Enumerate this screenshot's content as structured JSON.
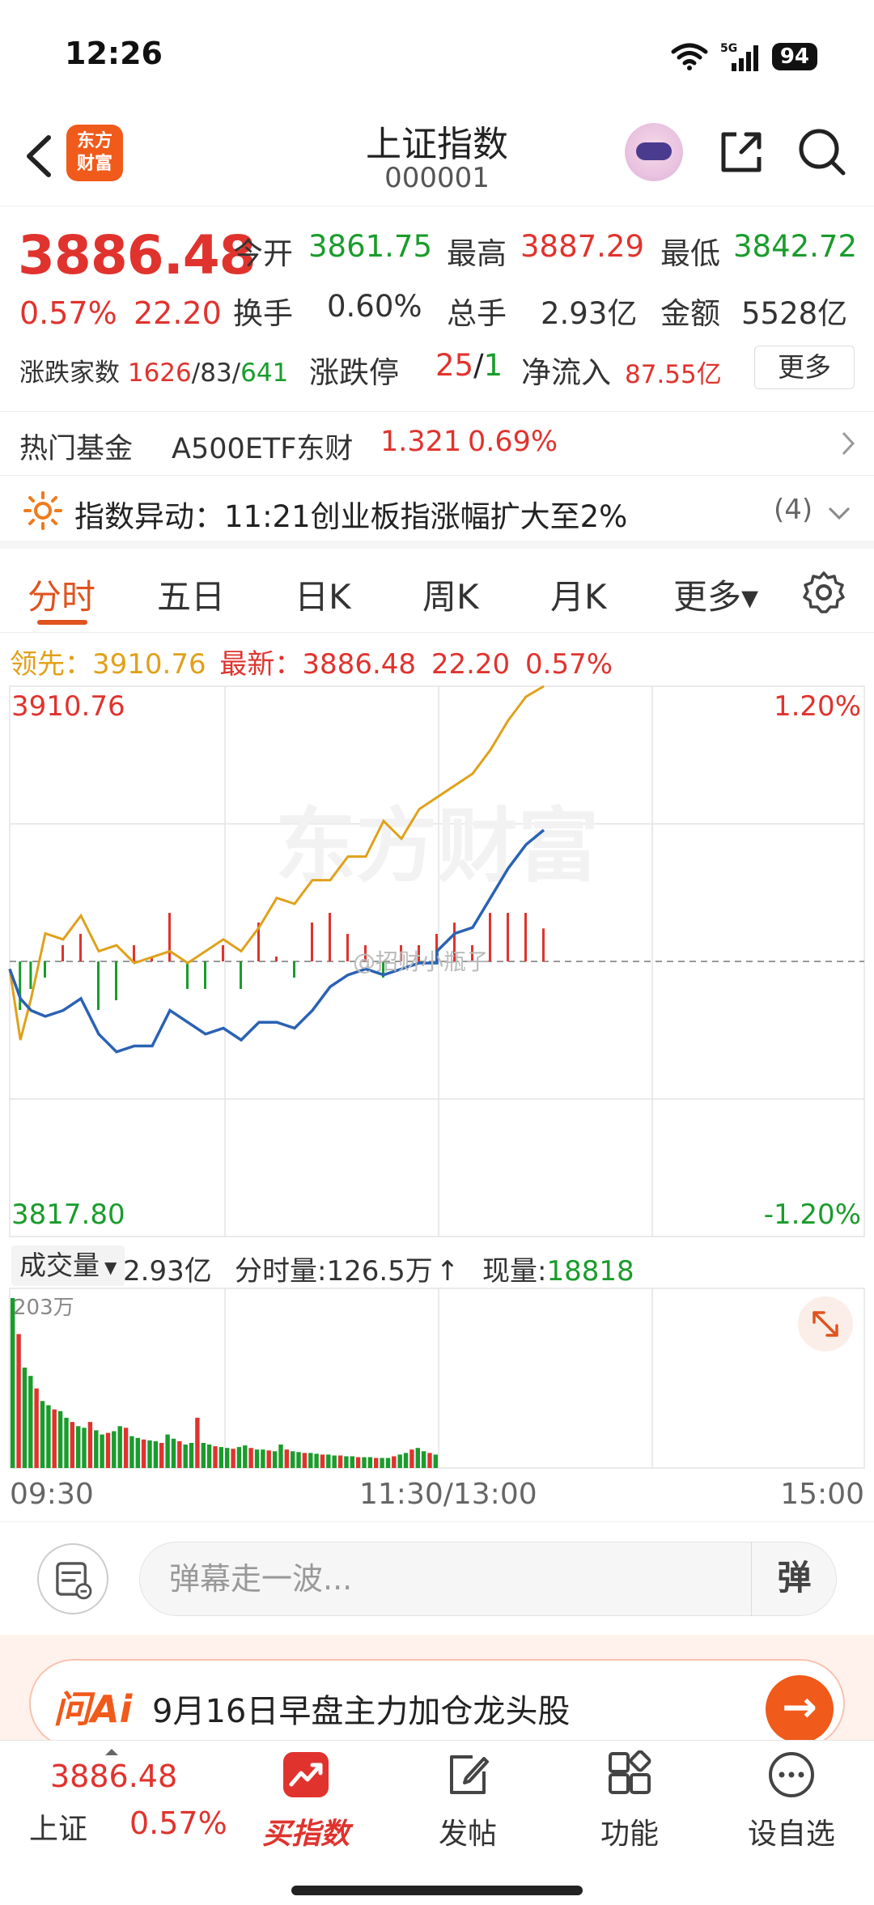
{
  "status_bar": {
    "time": "12:26",
    "battery": "94",
    "network": "5G"
  },
  "header": {
    "title": "上证指数",
    "code": "000001",
    "logo_text_line1": "东方",
    "logo_text_line2": "财富"
  },
  "quote": {
    "last_price": "3886.48",
    "pct_change": "0.57%",
    "abs_change": "22.20",
    "open_label": "今开",
    "open": "3861.75",
    "high_label": "最高",
    "high": "3887.29",
    "low_label": "最低",
    "low": "3842.72",
    "turnover_label": "换手",
    "turnover": "0.60%",
    "volume_label": "总手",
    "volume": "2.93亿",
    "amount_label": "金额",
    "amount": "5528亿",
    "adv_label": "涨跌家数",
    "adv_up": "1626",
    "adv_flat": "83",
    "adv_down": "641",
    "sep": "/",
    "limit_label": "涨跌停",
    "limit_up": "25",
    "limit_down": "1",
    "netflow_label": "净流入",
    "netflow": "87.55亿",
    "more_label": "更多"
  },
  "hot_fund": {
    "label": "热门基金",
    "name": "A500ETF东财",
    "price": "1.321",
    "pct": "0.69%"
  },
  "alert": {
    "label": "指数异动：",
    "text": "11:21创业板指涨幅扩大至2%",
    "count": "(4)"
  },
  "tabs": [
    {
      "label": "分时"
    },
    {
      "label": "五日"
    },
    {
      "label": "日K"
    },
    {
      "label": "周K"
    },
    {
      "label": "月K"
    },
    {
      "label": "更多▾"
    }
  ],
  "legend": {
    "lead_label": "领先：",
    "lead_value": "3910.76",
    "latest_label": "最新：",
    "latest_value": "3886.48",
    "latest_change": "22.20",
    "latest_pct": "0.57%"
  },
  "chart_labels": {
    "y_top": "3910.76",
    "y_bottom": "3817.80",
    "pct_top": "1.20%",
    "pct_bottom": "-1.20%",
    "watermark": "东方财富",
    "user_watermark": "@招财小瓶子"
  },
  "volume_bar": {
    "indicator": "成交量",
    "total": "2.93亿",
    "minute_label": "分时量:",
    "minute_value": "126.5万",
    "arrow": "↑",
    "now_label": "现量:",
    "now_value": "18818",
    "max_label": "203万"
  },
  "time_axis": {
    "start": "09:30",
    "mid": "11:30/13:00",
    "end": "15:00"
  },
  "danmaku": {
    "placeholder": "弹幕走一波...",
    "send_label": "弹"
  },
  "ai_banner": {
    "logo": "问Ai",
    "text": "9月16日早盘主力加仓龙头股",
    "go": "→"
  },
  "bottom_bar": {
    "price": "3886.48",
    "name": "上证",
    "pct": "0.57%",
    "items": [
      {
        "label": "买指数"
      },
      {
        "label": "发帖"
      },
      {
        "label": "功能"
      },
      {
        "label": "设自选"
      }
    ]
  },
  "chart_data": {
    "type": "line",
    "title": "",
    "x_range": [
      "09:30",
      "15:00"
    ],
    "ylim": [
      3817.8,
      3910.76
    ],
    "prev_close": 3864.28,
    "series": [
      {
        "name": "最新",
        "color": "#2a62b4",
        "x": [
          "09:30",
          "09:33",
          "09:36",
          "09:40",
          "09:45",
          "09:50",
          "09:55",
          "10:00",
          "10:05",
          "10:10",
          "10:15",
          "10:20",
          "10:25",
          "10:30",
          "10:35",
          "10:40",
          "10:45",
          "10:50",
          "10:55",
          "11:00",
          "11:05",
          "11:10",
          "11:15",
          "11:20",
          "11:25",
          "11:30",
          "13:00",
          "13:05",
          "13:10",
          "13:15",
          "13:20",
          "13:25",
          "13:30"
        ],
        "values": [
          3863,
          3858,
          3856,
          3855,
          3856,
          3858,
          3852,
          3849,
          3850,
          3850,
          3856,
          3854,
          3852,
          3853,
          3851,
          3854,
          3854,
          3853,
          3856,
          3860,
          3862,
          3863,
          3862,
          3863,
          3864,
          3864,
          3866,
          3869,
          3870,
          3875,
          3880,
          3884,
          3886.48
        ]
      },
      {
        "color": "#e0a11a",
        "x": [
          "09:30",
          "09:33",
          "09:36",
          "09:40",
          "09:45",
          "09:50",
          "09:55",
          "10:00",
          "10:05",
          "10:10",
          "10:15",
          "10:20",
          "10:25",
          "10:30",
          "10:35",
          "10:40",
          "10:45",
          "10:50",
          "10:55",
          "11:00",
          "11:05",
          "11:10",
          "11:15",
          "11:20",
          "11:25",
          "11:30",
          "13:00",
          "13:05",
          "13:10",
          "13:15",
          "13:20",
          "13:25",
          "13:30"
        ],
        "values": [
          3863,
          3851,
          3858,
          3869,
          3868,
          3872,
          3866,
          3867,
          3864,
          3865,
          3866,
          3864,
          3866,
          3868,
          3866,
          3870,
          3875,
          3874,
          3878,
          3878,
          3882,
          3882,
          3888,
          3885,
          3890,
          3892,
          3892,
          3894,
          3896,
          3900,
          3905,
          3909,
          3910.76
        ]
      }
    ],
    "volume": {
      "unit": "万",
      "max": 203,
      "values": [
        203,
        160,
        120,
        110,
        95,
        80,
        75,
        70,
        68,
        60,
        55,
        50,
        48,
        55,
        45,
        40,
        42,
        44,
        50,
        48,
        38,
        36,
        34,
        33,
        32,
        30,
        40,
        35,
        32,
        28,
        30,
        60,
        30,
        28,
        26,
        25,
        24,
        23,
        25,
        27,
        24,
        22,
        22,
        21,
        20,
        28,
        22,
        20,
        19,
        18,
        18,
        17,
        16,
        16,
        15,
        15,
        14,
        14,
        13,
        13,
        13,
        12,
        12,
        12,
        14,
        16,
        18,
        22,
        24,
        20,
        18,
        16
      ]
    }
  }
}
